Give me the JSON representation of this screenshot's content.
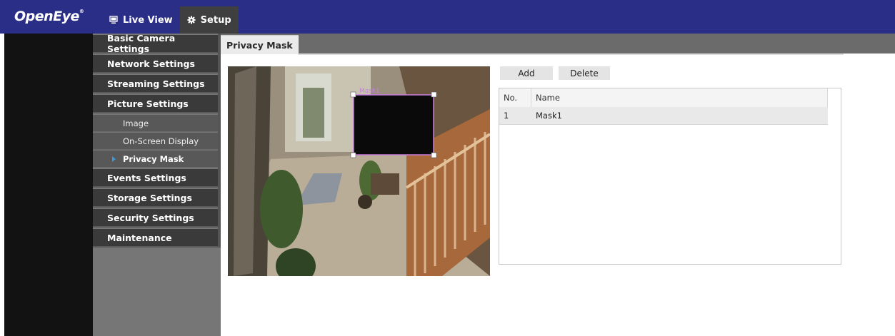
{
  "app": {
    "logo_text": "OpenEye",
    "logo_mark": "®"
  },
  "top_nav": [
    {
      "label": "Live View",
      "icon": "monitor-icon",
      "active": false
    },
    {
      "label": "Setup",
      "icon": "gear-icon",
      "active": true
    }
  ],
  "sidebar": {
    "sections": [
      {
        "label": "Basic Camera Settings"
      },
      {
        "label": "Network Settings"
      },
      {
        "label": "Streaming Settings"
      },
      {
        "label": "Picture Settings"
      },
      {
        "label": "Events Settings"
      },
      {
        "label": "Storage Settings"
      },
      {
        "label": "Security Settings"
      },
      {
        "label": "Maintenance"
      }
    ],
    "picture_sub_items": [
      {
        "label": "Image",
        "active": false
      },
      {
        "label": "On-Screen Display",
        "active": false
      },
      {
        "label": "Privacy Mask",
        "active": true
      }
    ]
  },
  "page": {
    "tab_label": "Privacy Mask"
  },
  "mask_editor": {
    "mask_label": "Mask1",
    "mask_color": "#c77ee0",
    "fill_color": "#0a0a0a"
  },
  "toolbar": {
    "add_label": "Add",
    "delete_label": "Delete"
  },
  "mask_table": {
    "columns": [
      "No.",
      "Name"
    ],
    "rows": [
      {
        "no": "1",
        "name": "Mask1"
      }
    ]
  },
  "colors": {
    "topbar": "#2a2e86",
    "sidebar_section": "#3a3a3a",
    "sidebar_sub": "#585858",
    "active_arrow": "#3a9ad9"
  }
}
